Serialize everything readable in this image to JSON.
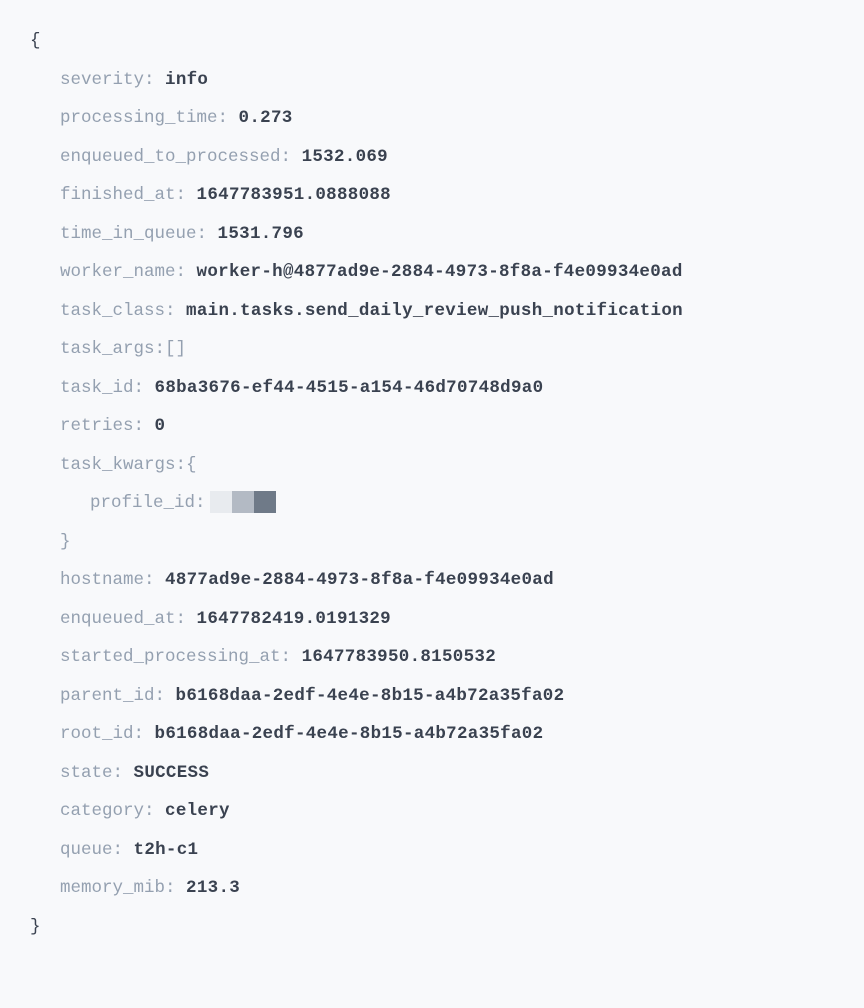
{
  "braces": {
    "open": "{",
    "close": "}",
    "open_bracket": "[",
    "close_bracket": "]"
  },
  "sep": ": ",
  "entries": {
    "severity": {
      "key": "severity",
      "value": "info"
    },
    "processing_time": {
      "key": "processing_time",
      "value": "0.273"
    },
    "enqueued_to_processed": {
      "key": "enqueued_to_processed",
      "value": "1532.069"
    },
    "finished_at": {
      "key": "finished_at",
      "value": "1647783951.0888088"
    },
    "time_in_queue": {
      "key": "time_in_queue",
      "value": "1531.796"
    },
    "worker_name": {
      "key": "worker_name",
      "value": "worker-h@4877ad9e-2884-4973-8f8a-f4e09934e0ad"
    },
    "task_class": {
      "key": "task_class",
      "value": "main.tasks.send_daily_review_push_notification"
    },
    "task_args": {
      "key": "task_args"
    },
    "task_id": {
      "key": "task_id",
      "value": "68ba3676-ef44-4515-a154-46d70748d9a0"
    },
    "retries": {
      "key": "retries",
      "value": "0"
    },
    "task_kwargs": {
      "key": "task_kwargs"
    },
    "profile_id": {
      "key": "profile_id"
    },
    "hostname": {
      "key": "hostname",
      "value": "4877ad9e-2884-4973-8f8a-f4e09934e0ad"
    },
    "enqueued_at": {
      "key": "enqueued_at",
      "value": "1647782419.0191329"
    },
    "started_processing_at": {
      "key": "started_processing_at",
      "value": "1647783950.8150532"
    },
    "parent_id": {
      "key": "parent_id",
      "value": "b6168daa-2edf-4e4e-8b15-a4b72a35fa02"
    },
    "root_id": {
      "key": "root_id",
      "value": "b6168daa-2edf-4e4e-8b15-a4b72a35fa02"
    },
    "state": {
      "key": "state",
      "value": "SUCCESS"
    },
    "category": {
      "key": "category",
      "value": "celery"
    },
    "queue": {
      "key": "queue",
      "value": "t2h-c1"
    },
    "memory_mib": {
      "key": "memory_mib",
      "value": "213.3"
    }
  }
}
